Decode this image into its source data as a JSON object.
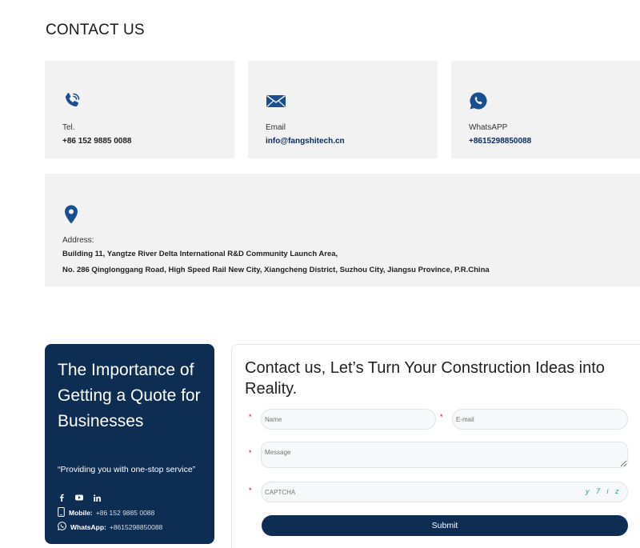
{
  "section_title": "CONTACT US",
  "contacts": {
    "tel": {
      "label": "Tel.",
      "value": "+86 152 9885 0088"
    },
    "email": {
      "label": "Email",
      "value": "info@fangshitech.cn"
    },
    "whatsapp": {
      "label": "WhatsAPP",
      "value": "+8615298850088"
    },
    "address": {
      "label": "Address:",
      "line1": "Building 11, Yangtze River Delta International R&D Community Launch Area,",
      "line2": "No. 286 Qinglonggang Road, High Speed Rail New City, Xiangcheng District, Suzhou City, Jiangsu Province, P.R.China"
    }
  },
  "promo": {
    "heading": "The Importance of Getting a Quote for Businesses",
    "quote": "“Providing you with one-stop service”",
    "mobile_label": "Mobile:",
    "mobile_value": "+86 152 9885 0088",
    "whatsapp_label": "WhatsApp:",
    "whatsapp_value": "+8615298850088"
  },
  "form": {
    "heading": "Contact us, Let’s Turn Your Construction Ideas into Reality.",
    "required_mark": "*",
    "name_placeholder": "Name",
    "email_placeholder": "E-mail",
    "message_placeholder": "Message",
    "captcha_placeholder": "CAPTCHA",
    "captcha_text": "y 7 i z",
    "submit_label": "Submit"
  },
  "colors": {
    "accent_blue": "#1a4f8f",
    "navy": "#0d2d52",
    "card_bg": "#f2f2f2",
    "required": "#d0021b"
  }
}
